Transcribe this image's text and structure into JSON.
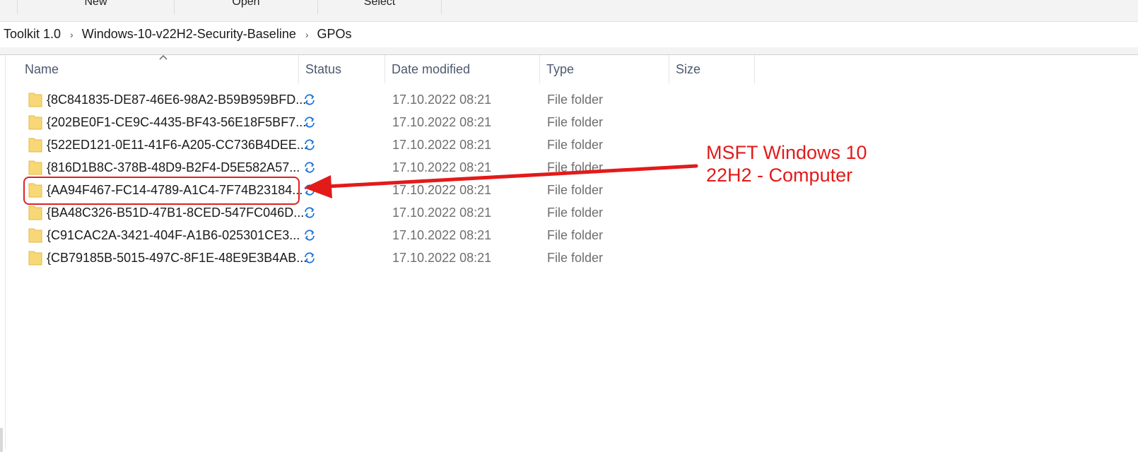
{
  "ribbon": {
    "groups": [
      "New",
      "Open",
      "Select"
    ]
  },
  "breadcrumb": {
    "items": [
      "Toolkit 1.0",
      "Windows-10-v22H2-Security-Baseline",
      "GPOs"
    ]
  },
  "columns": {
    "name": "Name",
    "status": "Status",
    "date": "Date modified",
    "type": "Type",
    "size": "Size"
  },
  "rows": [
    {
      "name": "{8C841835-DE87-46E6-98A2-B59B959BFD...",
      "status": "sync-icon",
      "date": "17.10.2022 08:21",
      "type": "File folder",
      "size": ""
    },
    {
      "name": "{202BE0F1-CE9C-4435-BF43-56E18F5BF7...",
      "status": "sync-icon",
      "date": "17.10.2022 08:21",
      "type": "File folder",
      "size": ""
    },
    {
      "name": "{522ED121-0E11-41F6-A205-CC736B4DEE...",
      "status": "sync-icon",
      "date": "17.10.2022 08:21",
      "type": "File folder",
      "size": ""
    },
    {
      "name": "{816D1B8C-378B-48D9-B2F4-D5E582A57...",
      "status": "sync-icon",
      "date": "17.10.2022 08:21",
      "type": "File folder",
      "size": ""
    },
    {
      "name": "{AA94F467-FC14-4789-A1C4-7F74B23184...",
      "status": "sync-icon",
      "date": "17.10.2022 08:21",
      "type": "File folder",
      "size": ""
    },
    {
      "name": "{BA48C326-B51D-47B1-8CED-547FC046D...",
      "status": "sync-icon",
      "date": "17.10.2022 08:21",
      "type": "File folder",
      "size": ""
    },
    {
      "name": "{C91CAC2A-3421-404F-A1B6-025301CE3...",
      "status": "sync-icon",
      "date": "17.10.2022 08:21",
      "type": "File folder",
      "size": ""
    },
    {
      "name": "{CB79185B-5015-497C-8F1E-48E9E3B4AB...",
      "status": "sync-icon",
      "date": "17.10.2022 08:21",
      "type": "File folder",
      "size": ""
    }
  ],
  "annotation": {
    "line1": "MSFT Windows 10",
    "line2": "22H2 - Computer",
    "color": "#e31a1a"
  },
  "colors": {
    "folder": "#f8d776",
    "sync": "#1a73d9",
    "header_text": "#4d5870"
  }
}
